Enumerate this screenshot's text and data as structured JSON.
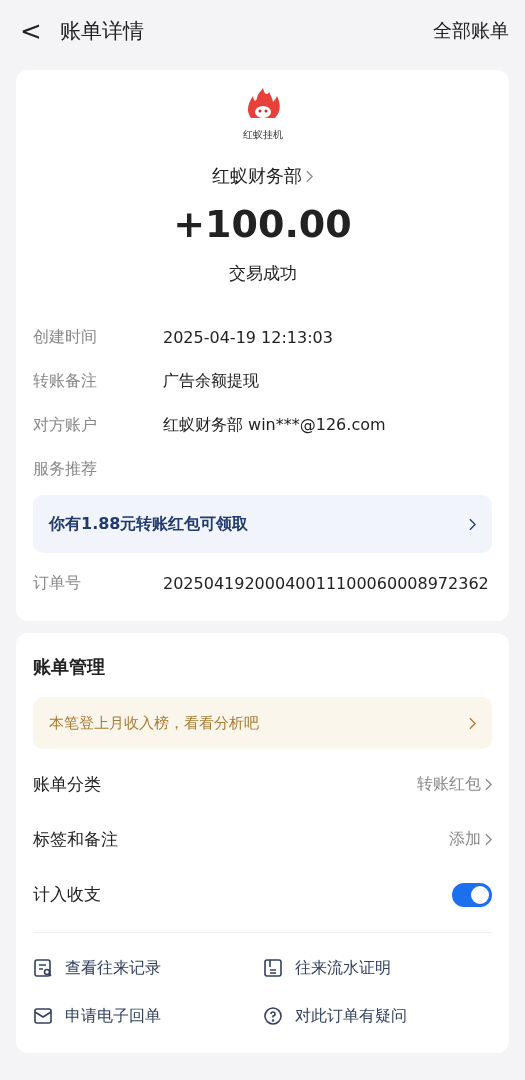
{
  "header": {
    "back": "<",
    "title": "账单详情",
    "right_link": "全部账单"
  },
  "summary": {
    "logo_text": "红蚁挂机",
    "payer": "红蚁财务部",
    "amount": "+100.00",
    "status": "交易成功"
  },
  "details": [
    {
      "kind": "text",
      "label": "创建时间",
      "value": "2025-04-19 12:13:03"
    },
    {
      "kind": "text",
      "label": "转账备注",
      "value": "广告余额提现"
    },
    {
      "kind": "text",
      "label": "对方账户",
      "value": "红蚁财务部 win***@126.com"
    },
    {
      "kind": "heading",
      "label": "服务推荐"
    },
    {
      "kind": "banner",
      "label": "你有1.88元转账红包可领取"
    },
    {
      "kind": "text",
      "label": "订单号",
      "value": "20250419200040011100060008972362"
    }
  ],
  "management": {
    "title": "账单管理",
    "banner": "本笔登上月收入榜，看看分析吧",
    "rows": [
      {
        "kind": "link",
        "label": "账单分类",
        "value": "转账红包"
      },
      {
        "kind": "link",
        "label": "标签和备注",
        "value": "添加"
      },
      {
        "kind": "toggle",
        "label": "计入收支",
        "on": true
      }
    ],
    "actions": [
      {
        "kind": "records",
        "label": "查看往来记录"
      },
      {
        "kind": "proof",
        "label": "往来流水证明"
      },
      {
        "kind": "mail",
        "label": "申请电子回单"
      },
      {
        "kind": "question",
        "label": "对此订单有疑问"
      }
    ]
  }
}
